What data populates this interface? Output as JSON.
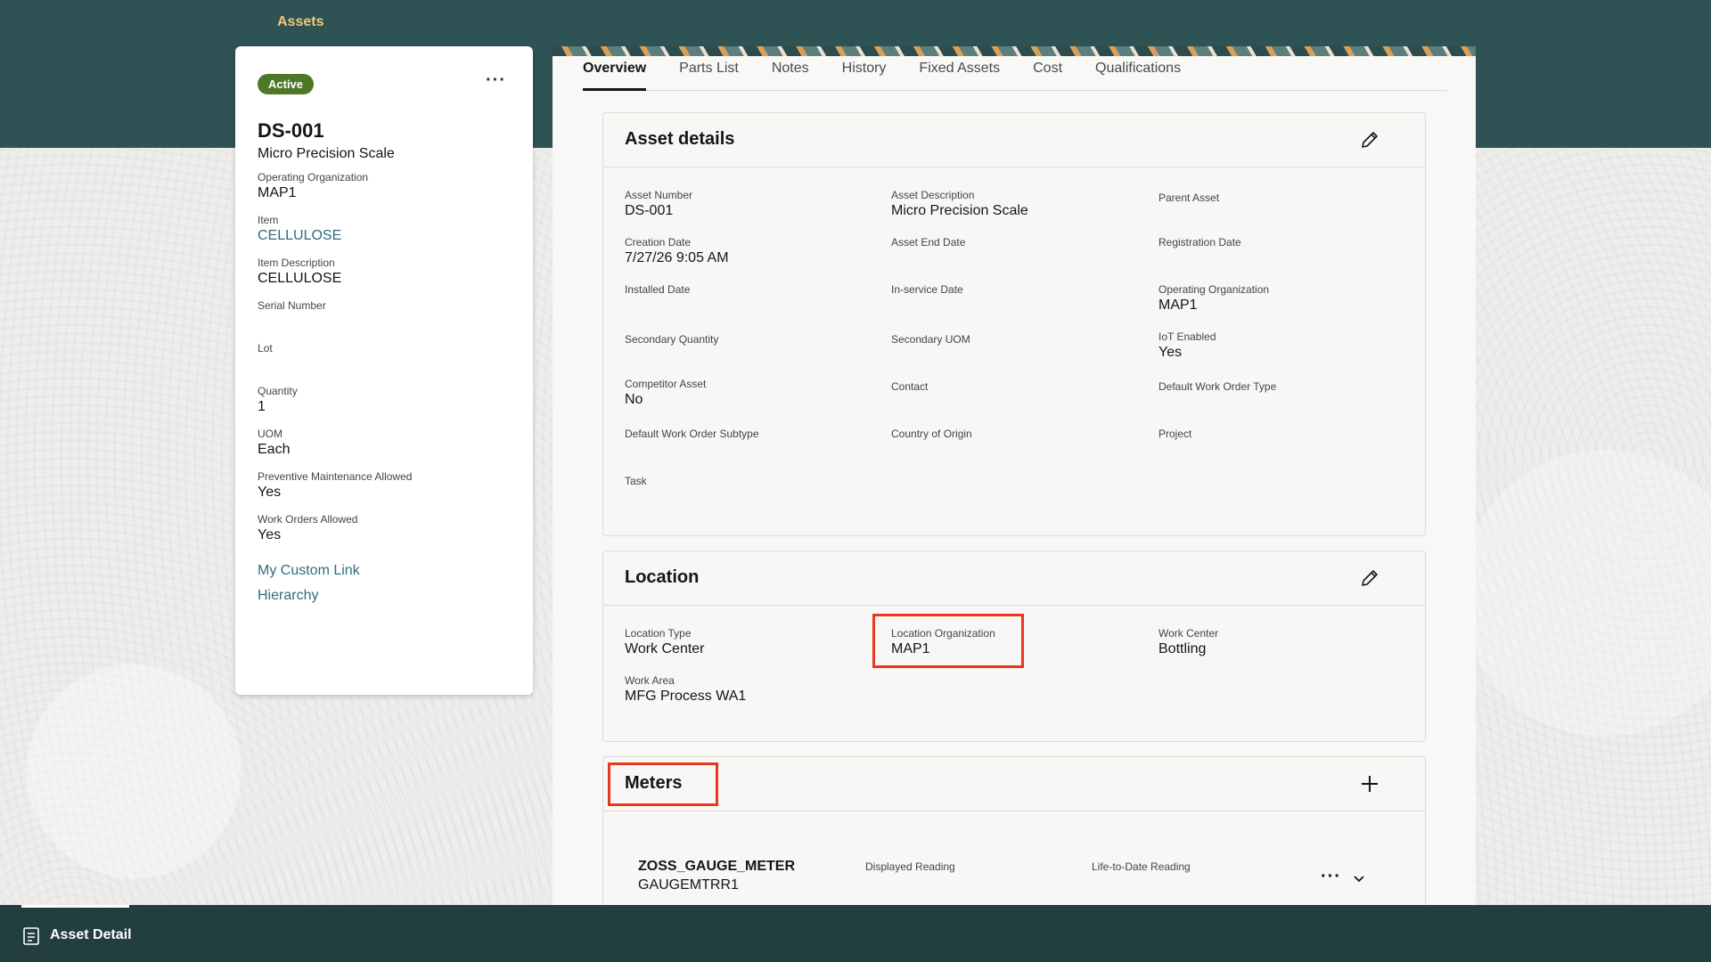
{
  "app": {
    "title": "Assets"
  },
  "left_card": {
    "status": "Active",
    "asset_number": "DS-001",
    "asset_description": "Micro Precision Scale",
    "fields": [
      {
        "label": "Operating Organization",
        "value": "MAP1",
        "link": false
      },
      {
        "label": "Item",
        "value": "CELLULOSE",
        "link": true
      },
      {
        "label": "Item Description",
        "value": "CELLULOSE",
        "link": false
      },
      {
        "label": "Serial Number",
        "value": "",
        "link": false
      },
      {
        "label": "Lot",
        "value": "",
        "link": false
      },
      {
        "label": "Quantity",
        "value": "1",
        "link": false
      },
      {
        "label": "UOM",
        "value": "Each",
        "link": false
      },
      {
        "label": "Preventive Maintenance Allowed",
        "value": "Yes",
        "link": false
      },
      {
        "label": "Work Orders Allowed",
        "value": "Yes",
        "link": false
      }
    ],
    "links": [
      "My Custom Link",
      "Hierarchy"
    ]
  },
  "tabs": [
    "Overview",
    "Parts List",
    "Notes",
    "History",
    "Fixed Assets",
    "Cost",
    "Qualifications"
  ],
  "active_tab": "Overview",
  "asset_details": {
    "title": "Asset details",
    "fields": [
      {
        "label": "Asset Number",
        "value": "DS-001"
      },
      {
        "label": "Asset Description",
        "value": "Micro Precision Scale"
      },
      {
        "label": "Parent Asset",
        "value": ""
      },
      {
        "label": "Creation Date",
        "value": "7/27/26 9:05 AM"
      },
      {
        "label": "Asset End Date",
        "value": ""
      },
      {
        "label": "Registration Date",
        "value": ""
      },
      {
        "label": "Installed Date",
        "value": ""
      },
      {
        "label": "In-service Date",
        "value": ""
      },
      {
        "label": "Operating Organization",
        "value": "MAP1"
      },
      {
        "label": "Secondary Quantity",
        "value": ""
      },
      {
        "label": "Secondary UOM",
        "value": ""
      },
      {
        "label": "IoT Enabled",
        "value": "Yes"
      },
      {
        "label": "Competitor Asset",
        "value": "No"
      },
      {
        "label": "Contact",
        "value": ""
      },
      {
        "label": "Default Work Order Type",
        "value": ""
      },
      {
        "label": "Default Work Order Subtype",
        "value": ""
      },
      {
        "label": "Country of Origin",
        "value": ""
      },
      {
        "label": "Project",
        "value": ""
      },
      {
        "label": "Task",
        "value": ""
      }
    ]
  },
  "location": {
    "title": "Location",
    "fields": [
      {
        "label": "Location Type",
        "value": "Work Center"
      },
      {
        "label": "Location Organization",
        "value": "MAP1"
      },
      {
        "label": "Work Center",
        "value": "Bottling"
      },
      {
        "label": "Work Area",
        "value": "MFG Process WA1"
      }
    ]
  },
  "meters": {
    "title": "Meters",
    "items": [
      {
        "name": "ZOSS_GAUGE_METER",
        "code": "GAUGEMTRR1",
        "displayed_reading_label": "Displayed Reading",
        "ltd_reading_label": "Life-to-Date Reading"
      }
    ]
  },
  "bottom_bar": {
    "tab_label": "Asset Detail"
  },
  "colors": {
    "header": "#2f5254",
    "title_accent": "#f3c877",
    "active_badge": "#4c7828",
    "highlight": "#e8381f",
    "bottom_bar": "#233e40",
    "link": "#2f6d7a"
  }
}
